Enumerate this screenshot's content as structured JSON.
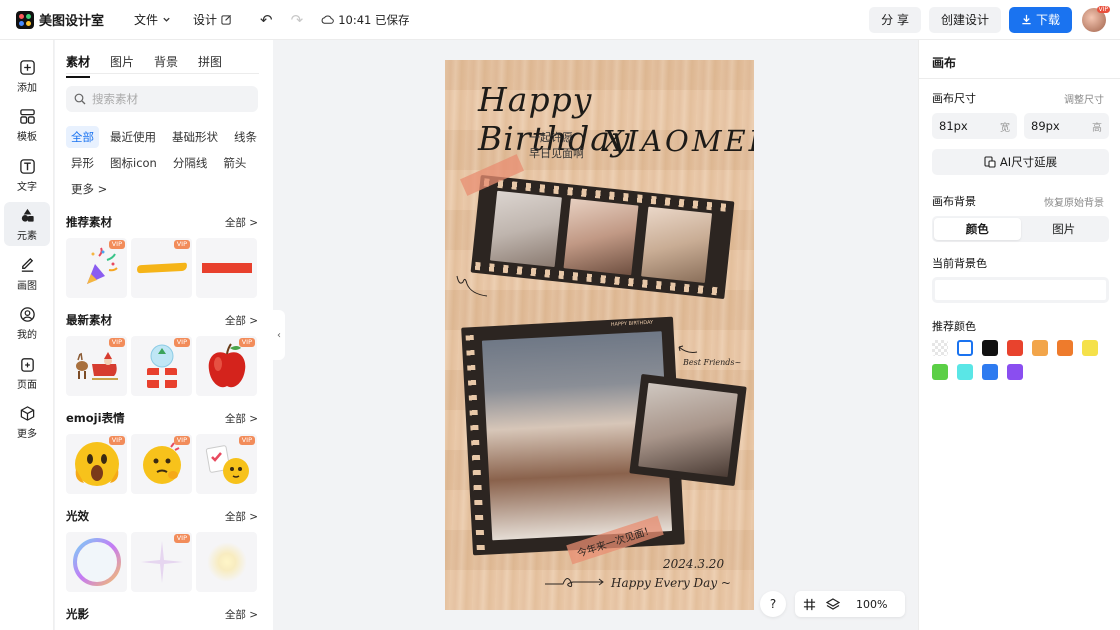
{
  "app": {
    "name": "美图设计室"
  },
  "menu": {
    "file": "文件",
    "design": "设计"
  },
  "status": {
    "saved": "10:41 已保存"
  },
  "top_actions": {
    "share": "分 享",
    "create": "创建设计",
    "download": "下载",
    "avatar_badge": "VIP"
  },
  "rail": [
    {
      "label": "添加",
      "icon": "plus-square-icon"
    },
    {
      "label": "模板",
      "icon": "template-icon"
    },
    {
      "label": "文字",
      "icon": "text-icon"
    },
    {
      "label": "元素",
      "icon": "shapes-icon"
    },
    {
      "label": "画图",
      "icon": "edit-icon"
    },
    {
      "label": "我的",
      "icon": "user-icon"
    },
    {
      "label": "页面",
      "icon": "page-icon"
    },
    {
      "label": "更多",
      "icon": "cube-icon"
    }
  ],
  "panel": {
    "tabs": [
      "素材",
      "图片",
      "背景",
      "拼图"
    ],
    "search_placeholder": "搜索素材",
    "chips": [
      "全部",
      "最近使用",
      "基础形状",
      "线条",
      "异形",
      "图标icon",
      "分隔线",
      "箭头",
      "更多 >"
    ],
    "sections": [
      {
        "title": "推荐素材",
        "all": "全部 >"
      },
      {
        "title": "最新素材",
        "all": "全部 >"
      },
      {
        "title": "emoji表情",
        "all": "全部 >"
      },
      {
        "title": "光效",
        "all": "全部 >"
      },
      {
        "title": "光影",
        "all": "全部 >"
      }
    ],
    "vip": "VIP"
  },
  "canvas": {
    "title_line1": "Happy Birthday",
    "title_line2": "XIAOMEI",
    "subtext_line1": "一起许愿",
    "subtext_line2": "早日见面啊",
    "note_best": "Best Friends~",
    "tape_text": "今年来一次见面！",
    "date": "2024.3.20",
    "footer": "Happy Every Day ~",
    "film_label": "HAPPY BIRTHDAY"
  },
  "bottom": {
    "help": "?",
    "zoom": "100%"
  },
  "right": {
    "title": "画布",
    "size_label": "画布尺寸",
    "size_link": "调整尺寸",
    "width_value": "81px",
    "width_unit": "宽",
    "height_value": "89px",
    "height_unit": "高",
    "ai_button": "AI尺寸延展",
    "bg_label": "画布背景",
    "bg_link": "恢复原始背景",
    "seg_color": "颜色",
    "seg_image": "图片",
    "current_label": "当前背景色",
    "recommend_label": "推荐颜色",
    "swatches": [
      "transparent",
      "#ffffff",
      "#111111",
      "#e8432d",
      "#f2a54a",
      "#ee7b2c",
      "#f5e14a",
      "#5bcf46",
      "#5ae6e6",
      "#2e7bf0",
      "#8a4ef0"
    ]
  }
}
